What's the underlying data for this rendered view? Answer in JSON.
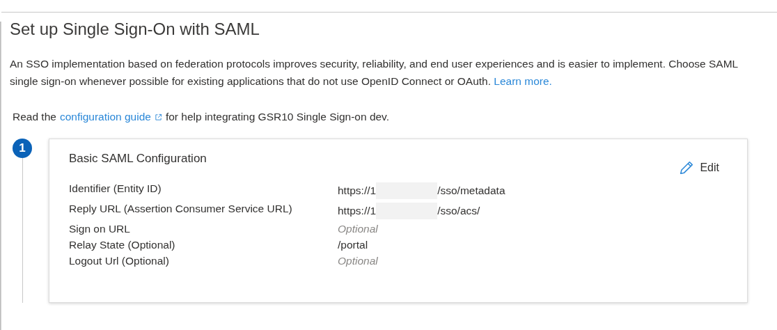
{
  "title": "Set up Single Sign-On with SAML",
  "intro": {
    "text": "An SSO implementation based on federation protocols improves security, reliability, and end user experiences and is easier to implement. Choose SAML single sign-on whenever possible for existing applications that do not use OpenID Connect or OAuth.",
    "link": "Learn more."
  },
  "guide": {
    "before": "Read the",
    "link": "configuration guide",
    "after": "for help integrating GSR10 Single Sign-on dev."
  },
  "steps": [
    {
      "number": "1",
      "title": "Basic SAML Configuration",
      "edit": "Edit",
      "rows": [
        {
          "label": "Identifier (Entity ID)",
          "kind": "redacted",
          "value": "https://1",
          "value_end": "/sso/metadata"
        },
        {
          "label": "Reply URL (Assertion Consumer Service URL)",
          "kind": "redacted",
          "value": "https://1",
          "value_end": "/sso/acs/"
        },
        {
          "label": "Sign on URL",
          "kind": "placeholder",
          "value": "Optional"
        },
        {
          "label": "Relay State (Optional)",
          "kind": "value",
          "value": "/portal"
        },
        {
          "label": "Logout Url (Optional)",
          "kind": "placeholder",
          "value": "Optional"
        }
      ]
    }
  ]
}
